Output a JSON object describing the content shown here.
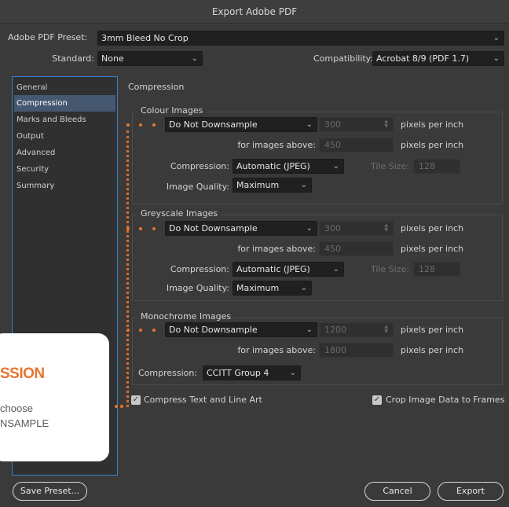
{
  "window": {
    "title": "Export Adobe PDF"
  },
  "top": {
    "preset_label": "Adobe PDF Preset:",
    "preset_value": "3mm Bleed No Crop",
    "standard_label": "Standard:",
    "standard_value": "None",
    "compat_label": "Compatibility:",
    "compat_value": "Acrobat 8/9 (PDF 1.7)"
  },
  "sidebar": {
    "items": [
      {
        "label": "General"
      },
      {
        "label": "Compression"
      },
      {
        "label": "Marks and Bleeds"
      },
      {
        "label": "Output"
      },
      {
        "label": "Advanced"
      },
      {
        "label": "Security"
      },
      {
        "label": "Summary"
      }
    ],
    "selected": "Compression"
  },
  "section_title": "Compression",
  "colour": {
    "title": "Colour Images",
    "downsample": "Do Not Downsample",
    "ppi_value": "300",
    "ppi_unit": "pixels per inch",
    "above_label": "for images above:",
    "above_value": "450",
    "above_unit": "pixels per inch",
    "compression_label": "Compression:",
    "compression_value": "Automatic (JPEG)",
    "tile_label": "Tile Size:",
    "tile_value": "128",
    "quality_label": "Image Quality:",
    "quality_value": "Maximum"
  },
  "grey": {
    "title": "Greyscale Images",
    "downsample": "Do Not Downsample",
    "ppi_value": "300",
    "ppi_unit": "pixels per inch",
    "above_label": "for images above:",
    "above_value": "450",
    "above_unit": "pixels per inch",
    "compression_label": "Compression:",
    "compression_value": "Automatic (JPEG)",
    "tile_label": "Tile Size:",
    "tile_value": "128",
    "quality_label": "Image Quality:",
    "quality_value": "Maximum"
  },
  "mono": {
    "title": "Monochrome Images",
    "downsample": "Do Not Downsample",
    "ppi_value": "1200",
    "ppi_unit": "pixels per inch",
    "above_label": "for images above:",
    "above_value": "1800",
    "above_unit": "pixels per inch",
    "compression_label": "Compression:",
    "compression_value": "CCITT Group 4"
  },
  "options": {
    "compress_text": "Compress Text and Line Art",
    "compress_text_checked": true,
    "crop_image": "Crop Image Data to Frames",
    "crop_image_checked": true
  },
  "buttons": {
    "save_preset": "Save Preset...",
    "cancel": "Cancel",
    "export": "Export"
  },
  "callout": {
    "title": "SSION",
    "line1": "choose",
    "line2": "NSAMPLE"
  },
  "colors": {
    "accent": "#e8742f",
    "selection": "#465870",
    "focus": "#3b7fd0"
  },
  "icons": {
    "dropdown": "chevron-down-icon",
    "spinner": "stepper-icon",
    "checkbox": "check-icon"
  }
}
